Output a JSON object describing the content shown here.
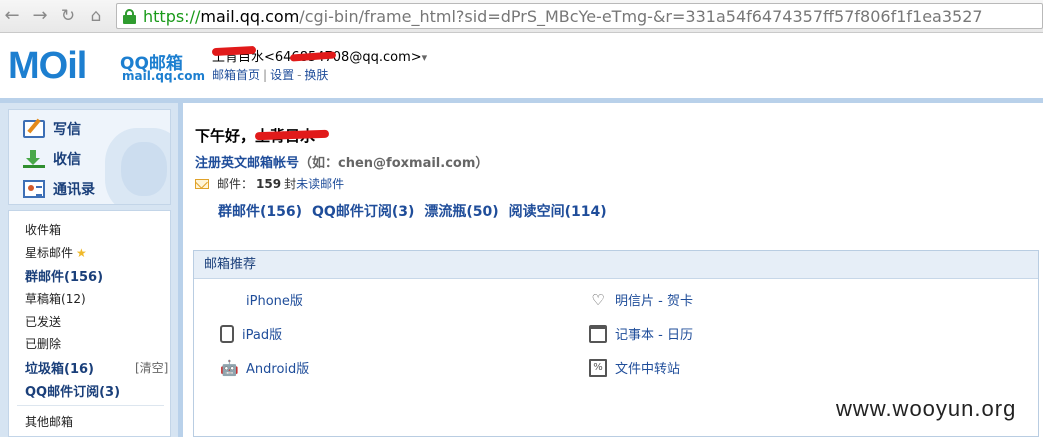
{
  "browser": {
    "url_scheme": "https://",
    "url_host": "mail.qq.com",
    "url_path": "/cgi-bin/frame_html?sid=dPrS_MBcYe-eTmg-&r=331a54f6474357ff57f806f1f1ea3527"
  },
  "header": {
    "logo_text": "MOil",
    "logo_cn": "QQ邮箱",
    "logo_domain": "mail.qq.com",
    "user_display": "土背目水<646854708@qq.com>",
    "user_caret": "▾",
    "links": [
      "邮箱首页",
      "设置",
      "换肤"
    ]
  },
  "sidebar": {
    "commands": [
      {
        "label": "写信",
        "icon": "write-icon"
      },
      {
        "label": "收信",
        "icon": "inbox-download-icon"
      },
      {
        "label": "通讯录",
        "icon": "contacts-icon"
      }
    ],
    "folders": {
      "inbox": "收件箱",
      "starred": "星标邮件",
      "group": "群邮件",
      "group_count": "(156)",
      "drafts": "草稿箱",
      "drafts_count": "(12)",
      "sent": "已发送",
      "deleted": "已删除",
      "spam": "垃圾箱",
      "spam_count": "(16)",
      "spam_clear": "[清空]",
      "subscriptions": "QQ邮件订阅",
      "subscriptions_count": "(3)",
      "other": "其他邮箱"
    }
  },
  "main": {
    "greeting": "下午好，",
    "greeting_name": "土背目水",
    "register_link": "注册英文邮箱帐号",
    "register_hint": "（如：chen@foxmail.com）",
    "mail_label": "邮件：",
    "mail_count": "159",
    "mail_unit": "封",
    "mail_unread": "未读邮件",
    "quick_links": [
      "群邮件(156)",
      "QQ邮件订阅(3)",
      "漂流瓶(50)",
      "阅读空间(114)"
    ],
    "recommend": {
      "title": "邮箱推荐",
      "items": [
        {
          "label": "iPhone版",
          "icon": "apple-icon"
        },
        {
          "label": "iPad版",
          "icon": "ipad-icon"
        },
        {
          "label": "Android版",
          "icon": "android-icon"
        },
        {
          "label": "明信片 - 贺卡",
          "icon": "heart-icon"
        },
        {
          "label": "记事本 - 日历",
          "icon": "calendar-icon"
        },
        {
          "label": "文件中转站",
          "icon": "file-transfer-icon"
        }
      ]
    }
  },
  "watermark": "www.wooyun.org"
}
